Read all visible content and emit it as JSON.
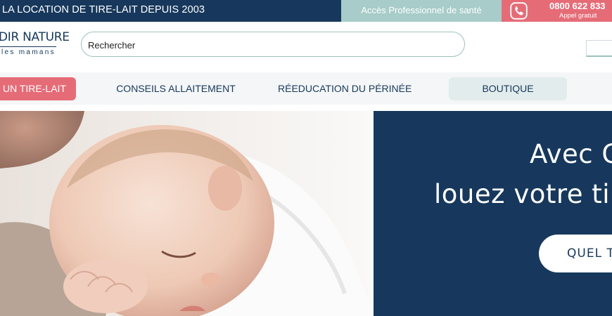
{
  "topbar": {
    "tagline": "LA LOCATION DE TIRE-LAIT DEPUIS 2003",
    "pro_link": "Accès Professionnel de santé",
    "phone_number": "0800 622 833",
    "phone_note": "Appel gratuit",
    "phone_icon": "phone-icon"
  },
  "header": {
    "logo_line1": "DIR NATURE",
    "logo_line2": "les mamans",
    "search_placeholder": "Rechercher"
  },
  "nav": {
    "items": [
      {
        "label": "UN TIRE-LAIT"
      },
      {
        "label": "CONSEILS ALLAITEMENT"
      },
      {
        "label": "RÉEDUCATION DU PÉRINÉE"
      },
      {
        "label": "BOUTIQUE"
      }
    ]
  },
  "hero": {
    "line1": "Avec G",
    "line2": "louez votre tire",
    "cta": "QUEL T"
  },
  "colors": {
    "navy": "#17385c",
    "coral": "#e56c77",
    "teal": "#a7ccc9"
  }
}
